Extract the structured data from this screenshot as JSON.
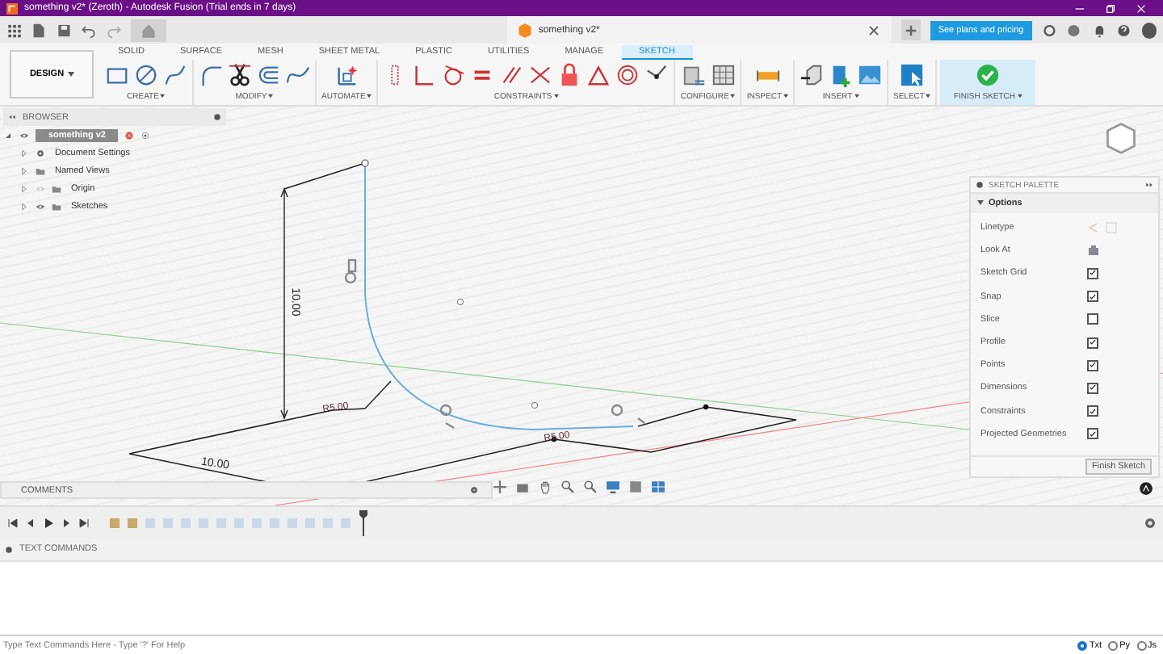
{
  "window": {
    "title": "something v2* (Zeroth) - Autodesk Fusion (Trial ends in 7 days)"
  },
  "document_tab": {
    "title": "something v2*"
  },
  "plans_button": "See plans and pricing",
  "workspace_button": "DESIGN",
  "tabs": [
    {
      "label": "SOLID",
      "selected": false
    },
    {
      "label": "SURFACE",
      "selected": false
    },
    {
      "label": "MESH",
      "selected": false
    },
    {
      "label": "SHEET METAL",
      "selected": false
    },
    {
      "label": "PLASTIC",
      "selected": false
    },
    {
      "label": "UTILITIES",
      "selected": false
    },
    {
      "label": "MANAGE",
      "selected": false
    },
    {
      "label": "SKETCH",
      "selected": true
    }
  ],
  "tool_groups": [
    {
      "label": "CREATE"
    },
    {
      "label": "MODIFY"
    },
    {
      "label": "AUTOMATE"
    },
    {
      "label": "CONSTRAINTS"
    },
    {
      "label": "CONFIGURE"
    },
    {
      "label": "INSPECT"
    },
    {
      "label": "INSERT"
    },
    {
      "label": "SELECT"
    },
    {
      "label": "FINISH SKETCH"
    }
  ],
  "browser": {
    "title": "BROWSER",
    "items": [
      {
        "label": "something v2",
        "selected": true,
        "expanded": true,
        "visible": true,
        "children": [
          {
            "label": "Document Settings",
            "expanded": false
          },
          {
            "label": "Named Views",
            "expanded": false
          },
          {
            "label": "Origin",
            "expanded": false,
            "visible": false
          },
          {
            "label": "Sketches",
            "expanded": false,
            "visible": true
          }
        ]
      }
    ]
  },
  "sketch_dimensions": [
    {
      "kind": "vertical",
      "text": "10.00"
    },
    {
      "kind": "radius",
      "text": "R5.00"
    },
    {
      "kind": "radius",
      "text": "R5.00"
    },
    {
      "kind": "linear",
      "text": "10.00"
    }
  ],
  "sketch_palette": {
    "title": "SKETCH PALETTE",
    "section": {
      "label": "Options",
      "expanded": true
    },
    "rows": [
      {
        "kind": "linetype",
        "label": "Linetype"
      },
      {
        "kind": "button",
        "label": "Look At"
      },
      {
        "kind": "checkbox",
        "label": "Sketch Grid",
        "checked": true
      },
      {
        "kind": "checkbox",
        "label": "Snap",
        "checked": true
      },
      {
        "kind": "checkbox",
        "label": "Slice",
        "checked": false
      },
      {
        "kind": "checkbox",
        "label": "Profile",
        "checked": true
      },
      {
        "kind": "checkbox",
        "label": "Points",
        "checked": true
      },
      {
        "kind": "checkbox",
        "label": "Dimensions",
        "checked": true
      },
      {
        "kind": "checkbox",
        "label": "Constraints",
        "checked": true
      },
      {
        "kind": "checkbox",
        "label": "Projected Geometries",
        "checked": true
      }
    ],
    "finish_button": "Finish Sketch"
  },
  "comments": {
    "title": "COMMENTS"
  },
  "text_commands": {
    "title": "TEXT COMMANDS",
    "placeholder": "Type Text Commands Here - Type '?' For Help",
    "modes": [
      {
        "label": "Txt",
        "selected": true
      },
      {
        "label": "Py",
        "selected": false
      },
      {
        "label": "Js",
        "selected": false
      }
    ]
  }
}
